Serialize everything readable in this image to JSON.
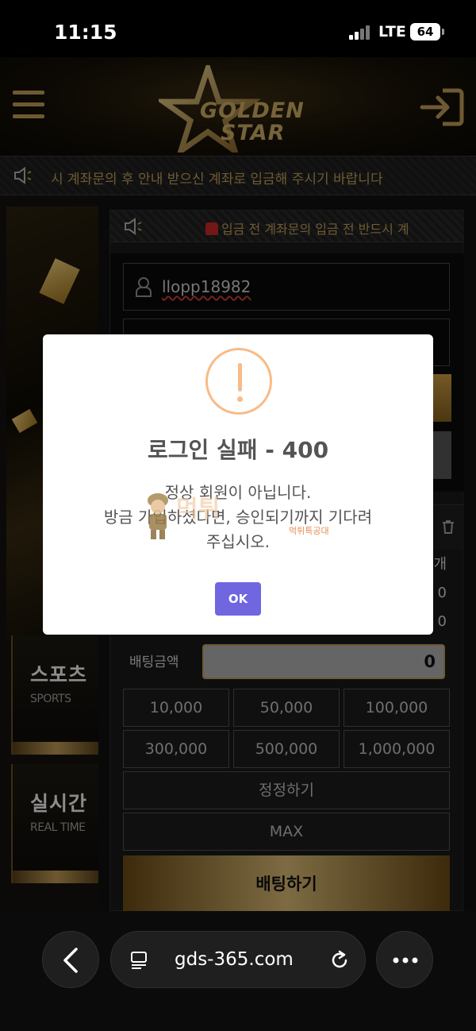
{
  "status_bar": {
    "time": "11:15",
    "network": "LTE",
    "battery": "64"
  },
  "site": {
    "logo_line1": "GOLDEN",
    "logo_line2": "STAR",
    "notice_marquee": "시 계좌문의 후 안내 받으신 계좌로 입금해 주시기 바랍니다",
    "panel_notice": "입금 전 계좌문의 입금 전 반드시 계",
    "login": {
      "username_value": "llopp18982"
    },
    "categories": [
      {
        "label": "스포츠",
        "sub": "SPORTS"
      },
      {
        "label": "실시간",
        "sub": "REAL TIME"
      }
    ],
    "betslip": {
      "count_suffix": "개",
      "row2": "0",
      "row3": "0",
      "bet_amount_label": "배팅금액",
      "bet_amount_value": "0",
      "amounts": [
        "10,000",
        "50,000",
        "100,000",
        "300,000",
        "500,000",
        "1,000,000"
      ],
      "reset_label": "정정하기",
      "max_label": "MAX",
      "bet_button": "배팅하기"
    }
  },
  "modal": {
    "title": "로그인 실패 - 400",
    "message_line1": "정상 회원이 아닙니다.",
    "message_line2": "방금 가입하셨다면, 승인되기까지 기다려",
    "message_line3": "주십시오.",
    "ok_label": "OK",
    "icon": "warning-icon"
  },
  "watermark": {
    "big": "먹튀",
    "small": "먹튀특공대"
  },
  "browser": {
    "url": "gds-365.com"
  },
  "colors": {
    "gold": "#c9a45c",
    "ok_button": "#7066e0",
    "warning": "#f8bb86"
  }
}
